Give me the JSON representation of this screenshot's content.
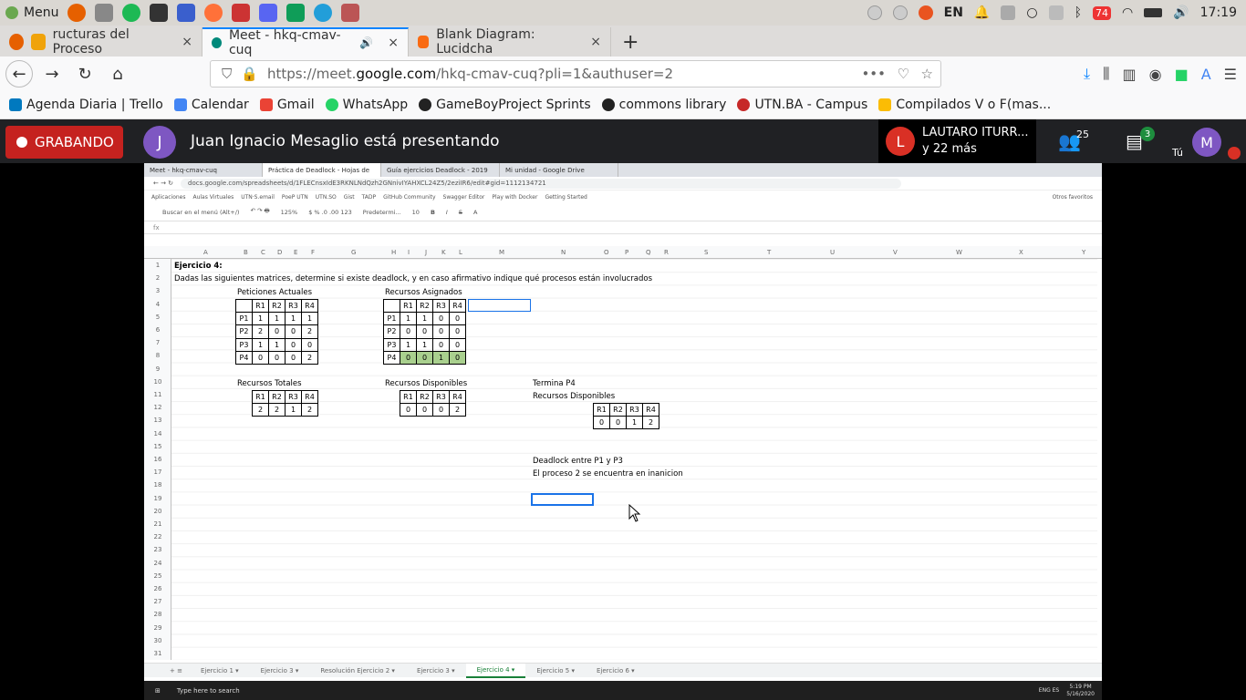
{
  "os_panel": {
    "menu_label": "Menu",
    "lang": "EN",
    "notif_count": "74",
    "time": "17:19"
  },
  "tabs": [
    {
      "label": "ructuras del Proceso",
      "close": "×"
    },
    {
      "label": "Meet - hkq-cmav-cuq",
      "close": "×"
    },
    {
      "label": "Blank Diagram: Lucidcha",
      "close": "×"
    }
  ],
  "newtab": "+",
  "url": {
    "prefix": "https://meet.",
    "domain": "google.com",
    "rest": "/hkq-cmav-cuq?pli=1&authuser=2"
  },
  "bookmarks": [
    "Agenda Diaria | Trello",
    "Calendar",
    "Gmail",
    "WhatsApp",
    "GameBoyProject Sprints",
    "commons library",
    "UTN.BA - Campus",
    "Compilados V o F(mas..."
  ],
  "meet": {
    "recording": "GRABANDO",
    "presenter_initial": "J",
    "presenter_text": "Juan Ignacio Mesaglio está presentando",
    "participant_initial": "L",
    "participant_name": "LAUTARO ITURR...",
    "participant_more": "y 22 más",
    "people_count": "25",
    "chat_count": "3",
    "me_initial": "M",
    "me_label": "Tú"
  },
  "shared": {
    "tabs": [
      "Meet - hkq-cmav-cuq",
      "Práctica de Deadlock - Hojas de",
      "Guía ejercicios Deadlock - 2019",
      "Mi unidad - Google Drive"
    ],
    "url": "docs.google.com/spreadsheets/d/1FLECnsxIdE3RKNLNdQzh2GNnivIYAHXCL24Z5/2eziIR6/edit#gid=1112134721",
    "bookmarks": [
      "Aplicaciones",
      "Aulas Virtuales",
      "UTN·S.email",
      "PoeP UTN",
      "UTN.SO",
      "Gist",
      "TADP",
      "GitHub Community",
      "Swagger Editor",
      "Play with Docker",
      "Getting Started",
      "Otros favoritos"
    ],
    "toolbar": {
      "menu_search": "Buscar en el menú (Alt+/)",
      "zoom": "125%",
      "font": "Predetermi...",
      "size": "10"
    },
    "columns": [
      "A",
      "B",
      "C",
      "D",
      "E",
      "F",
      "G",
      "H",
      "I",
      "J",
      "K",
      "L",
      "M",
      "N",
      "O",
      "P",
      "Q",
      "R",
      "S",
      "T",
      "U",
      "V",
      "W",
      "X",
      "Y"
    ],
    "rows": [
      "1",
      "2",
      "3",
      "4",
      "5",
      "6",
      "7",
      "8",
      "9",
      "10",
      "11",
      "12",
      "13",
      "14",
      "15",
      "16",
      "17",
      "18",
      "19",
      "20",
      "21",
      "22",
      "23",
      "24",
      "25",
      "26",
      "27",
      "28",
      "29",
      "30",
      "31"
    ],
    "title": "Ejercicio 4:",
    "description": "Dadas las siguientes matrices, determine si existe deadlock, y en caso afirmativo indique qué procesos están involucrados",
    "peticiones_label": "Peticiones Actuales",
    "asignados_label": "Recursos Asignados",
    "totales_label": "Recursos Totales",
    "disponibles_label": "Recursos Disponibles",
    "termina_label": "Termina P4",
    "disponibles2_label": "Recursos Disponibles",
    "deadlock_text": "Deadlock entre P1 y P3",
    "inanicion_text": "El proceso 2 se encuentra en inanicion",
    "res_headers": [
      "R1",
      "R2",
      "R3",
      "R4"
    ],
    "peticiones": [
      [
        "P1",
        "1",
        "1",
        "1",
        "1"
      ],
      [
        "P2",
        "2",
        "0",
        "0",
        "2"
      ],
      [
        "P3",
        "1",
        "1",
        "0",
        "0"
      ],
      [
        "P4",
        "0",
        "0",
        "0",
        "2"
      ]
    ],
    "asignados": [
      [
        "P1",
        "1",
        "1",
        "0",
        "0"
      ],
      [
        "P2",
        "0",
        "0",
        "0",
        "0"
      ],
      [
        "P3",
        "1",
        "1",
        "0",
        "0"
      ],
      [
        "P4",
        "0",
        "0",
        "1",
        "0"
      ]
    ],
    "totales": [
      "2",
      "2",
      "1",
      "2"
    ],
    "disponibles": [
      "0",
      "0",
      "0",
      "2"
    ],
    "disponibles2": [
      "0",
      "0",
      "1",
      "2"
    ],
    "sheets": [
      "Ejercicio 1",
      "Ejercicio 3",
      "Resolución Ejercicio 2",
      "Ejercicio 3",
      "Ejercicio 4",
      "Ejercicio 5",
      "Ejercicio 6"
    ],
    "taskbar_search": "Type here to search",
    "taskbar_time": "5:19 PM",
    "taskbar_date": "5/16/2020",
    "taskbar_lang": "ENG ES"
  },
  "colors": {
    "accent": "#0a84ff",
    "record": "#c5221f",
    "meet_bg": "#202124",
    "green_cell": "#a9d08e",
    "sheet_green": "#188038"
  }
}
